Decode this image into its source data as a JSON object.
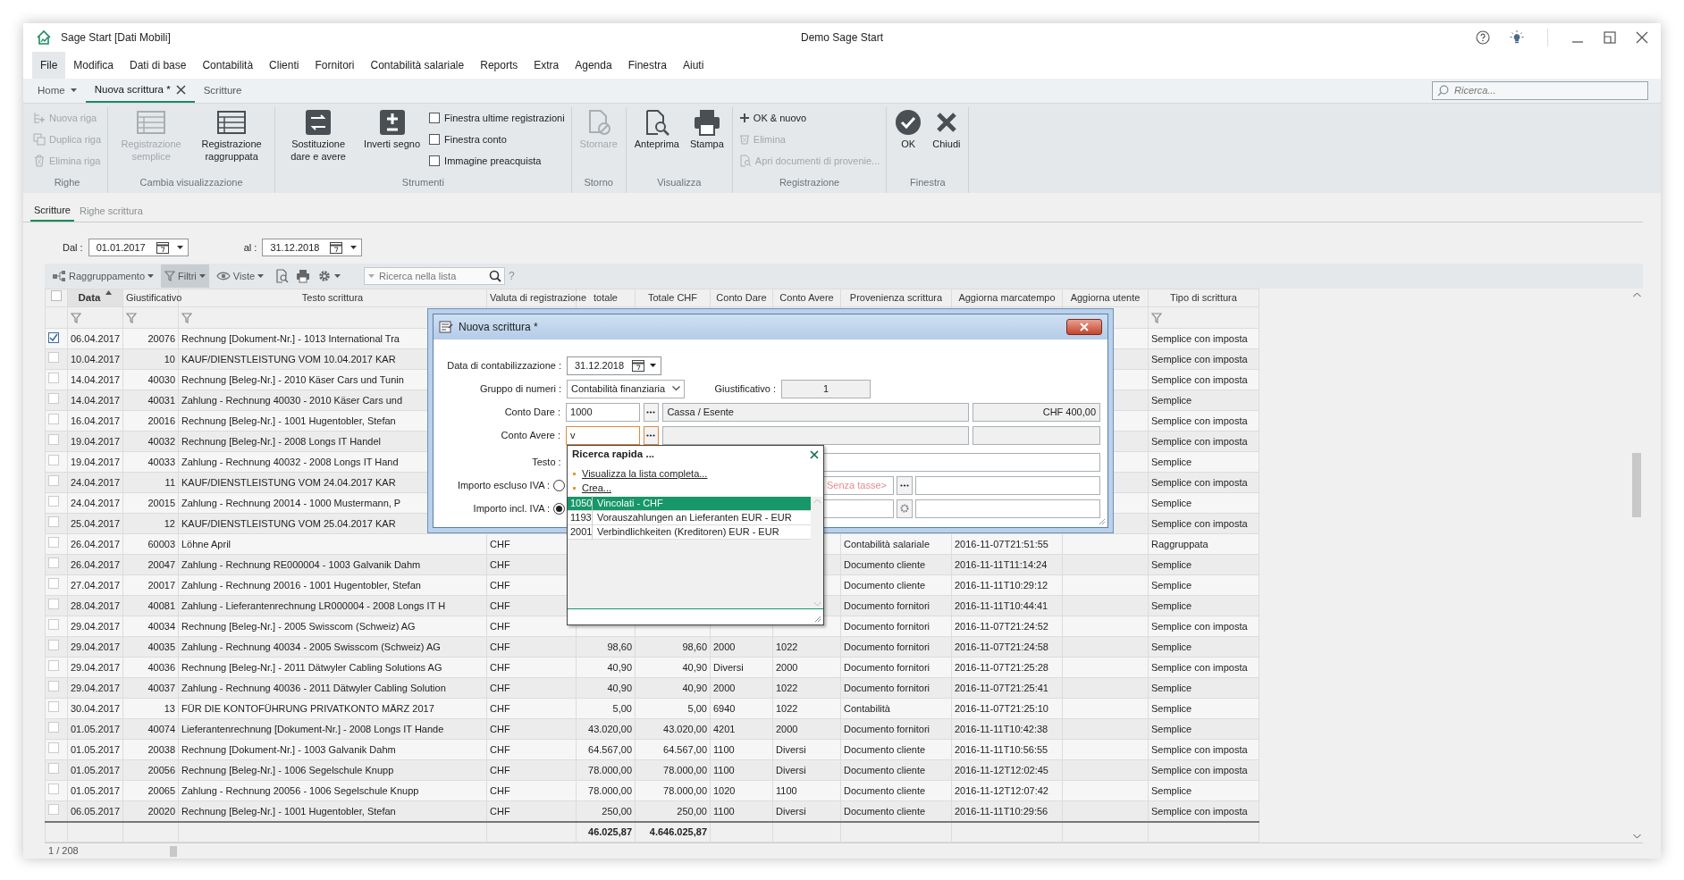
{
  "window": {
    "title": "Sage Start [Dati Mobili]",
    "center_title": "Demo Sage Start"
  },
  "menu": [
    {
      "label": "File",
      "selected": true
    },
    {
      "label": "Modifica",
      "selected": false
    },
    {
      "label": "Dati di base",
      "selected": false
    },
    {
      "label": "Contabilità",
      "selected": false
    },
    {
      "label": "Clienti",
      "selected": false
    },
    {
      "label": "Fornitori",
      "selected": false
    },
    {
      "label": "Contabilità salariale",
      "selected": false
    },
    {
      "label": "Reports",
      "selected": false
    },
    {
      "label": "Extra",
      "selected": false
    },
    {
      "label": "Agenda",
      "selected": false
    },
    {
      "label": "Finestra",
      "selected": false
    },
    {
      "label": "Aiuti",
      "selected": false
    }
  ],
  "doc_tabs": [
    {
      "label": "Home",
      "kind": "home",
      "selected": false
    },
    {
      "label": "Nuova scrittura *",
      "kind": "document",
      "selected": true
    },
    {
      "label": "Scritture",
      "kind": "plain",
      "selected": false
    }
  ],
  "global_search": {
    "placeholder": "Ricerca..."
  },
  "ribbon": [
    {
      "label": "Righe",
      "items": [
        {
          "kind": "small",
          "label": "Nuova riga",
          "disabled": true
        },
        {
          "kind": "small",
          "label": "Duplica riga",
          "disabled": true
        },
        {
          "kind": "small",
          "label": "Elimina riga",
          "disabled": true
        }
      ]
    },
    {
      "label": "Cambia visualizzazione",
      "items": [
        {
          "kind": "large",
          "label": "Registrazione semplice",
          "disabled": true
        },
        {
          "kind": "large",
          "label": "Registrazione raggruppata",
          "disabled": false
        }
      ]
    },
    {
      "label": "Strumenti",
      "items": [
        {
          "kind": "large",
          "label": "Sostituzione dare e avere",
          "disabled": false
        },
        {
          "kind": "large",
          "label": "Inverti segno",
          "disabled": false
        },
        {
          "kind": "check",
          "label": "Finestra ultime registrazioni",
          "checked": false
        },
        {
          "kind": "check",
          "label": "Finestra conto",
          "checked": false
        },
        {
          "kind": "check",
          "label": "Immagine preacquista",
          "checked": false
        }
      ]
    },
    {
      "label": "Storno",
      "items": [
        {
          "kind": "large",
          "label": "Stornare",
          "disabled": true
        }
      ]
    },
    {
      "label": "Visualizza",
      "items": [
        {
          "kind": "large",
          "label": "Anteprima",
          "disabled": false
        },
        {
          "kind": "large",
          "label": "Stampa",
          "disabled": false
        }
      ]
    },
    {
      "label": "Registrazione",
      "items": [
        {
          "kind": "small",
          "label": "OK & nuovo",
          "disabled": false
        },
        {
          "kind": "small",
          "label": "Elimina",
          "disabled": true
        },
        {
          "kind": "small",
          "label": "Apri documenti di provenie...",
          "disabled": true
        }
      ]
    },
    {
      "label": "Finestra",
      "items": [
        {
          "kind": "large",
          "label": "OK",
          "disabled": false
        },
        {
          "kind": "large",
          "label": "Chiudi",
          "disabled": false
        }
      ]
    }
  ],
  "sub_tabs": [
    {
      "label": "Scritture",
      "selected": true
    },
    {
      "label": "Righe scrittura",
      "selected": false
    }
  ],
  "date_filter": {
    "from_label": "Dal :",
    "from": "01.01.2017",
    "to_label": "al :",
    "to": "31.12.2018"
  },
  "toolbar": {
    "buttons": [
      {
        "label": "Raggruppamento",
        "pressed": false
      },
      {
        "label": "Filtri",
        "pressed": true
      },
      {
        "label": "Viste",
        "pressed": false
      }
    ],
    "search_placeholder": "Ricerca nella lista",
    "help": "?"
  },
  "table": {
    "all_checked": false,
    "columns": [
      {
        "label": "Data",
        "sorted": true
      },
      {
        "label": "Giustificativo",
        "sorted": false
      },
      {
        "label": "Testo scrittura",
        "sorted": false
      },
      {
        "label": "Valuta di registrazione",
        "sorted": false
      },
      {
        "label": "totale",
        "sorted": false
      },
      {
        "label": "Totale CHF",
        "sorted": false
      },
      {
        "label": "Conto Dare",
        "sorted": false
      },
      {
        "label": "Conto Avere",
        "sorted": false
      },
      {
        "label": "Provenienza scrittura",
        "sorted": false
      },
      {
        "label": "Aggiorna marcatempo",
        "sorted": false
      },
      {
        "label": "Aggiorna utente",
        "sorted": false
      },
      {
        "label": "Tipo di scrittura",
        "sorted": false
      }
    ],
    "rows": [
      {
        "checked": true,
        "date": "06.04.2017",
        "voucher": "20076",
        "text": "Rechnung [Dokument-Nr.] - 1013 International Tra",
        "type": "Semplice con imposta"
      },
      {
        "checked": false,
        "date": "10.04.2017",
        "voucher": "10",
        "text": "KAUF/DIENSTLEISTUNG VOM 10.04.2017 KAR",
        "type": "Semplice con imposta"
      },
      {
        "checked": false,
        "date": "14.04.2017",
        "voucher": "40030",
        "text": "Rechnung [Beleg-Nr.] - 2010 Käser Cars und Tunin",
        "type": "Semplice con imposta"
      },
      {
        "checked": false,
        "date": "14.04.2017",
        "voucher": "40031",
        "text": "Zahlung - Rechnung 40030 - 2010 Käser Cars und",
        "type": "Semplice"
      },
      {
        "checked": false,
        "date": "16.04.2017",
        "voucher": "20016",
        "text": "Rechnung [Beleg-Nr.] - 1001 Hugentobler, Stefan",
        "type": "Semplice con imposta"
      },
      {
        "checked": false,
        "date": "19.04.2017",
        "voucher": "40032",
        "text": "Rechnung [Beleg-Nr.] - 2008 Longs IT Handel",
        "type": "Semplice con imposta"
      },
      {
        "checked": false,
        "date": "19.04.2017",
        "voucher": "40033",
        "text": "Zahlung - Rechnung 40032 - 2008 Longs IT Hand",
        "type": "Semplice"
      },
      {
        "checked": false,
        "date": "24.04.2017",
        "voucher": "11",
        "text": "KAUF/DIENSTLEISTUNG VOM 24.04.2017 KAR",
        "type": "Semplice con imposta"
      },
      {
        "checked": false,
        "date": "24.04.2017",
        "voucher": "20015",
        "text": "Zahlung - Rechnung 20014 - 1000 Mustermann, P",
        "type": "Semplice"
      },
      {
        "checked": false,
        "date": "25.04.2017",
        "voucher": "12",
        "text": "KAUF/DIENSTLEISTUNG VOM 25.04.2017 KAR",
        "type": "Semplice con imposta"
      },
      {
        "checked": false,
        "date": "26.04.2017",
        "voucher": "60003",
        "text": "Löhne April",
        "currency": "CHF",
        "source": "Contabilità salariale",
        "timestamp": "2016-11-07T21:51:55",
        "type": "Raggruppata"
      },
      {
        "checked": false,
        "date": "26.04.2017",
        "voucher": "20047",
        "text": "Zahlung - Rechnung RE000004 - 1003 Galvanik Dahm",
        "currency": "CHF",
        "source": "Documento cliente",
        "timestamp": "2016-11-11T11:14:24",
        "type": "Semplice"
      },
      {
        "checked": false,
        "date": "27.04.2017",
        "voucher": "20017",
        "text": "Zahlung - Rechnung 20016 - 1001 Hugentobler, Stefan",
        "currency": "CHF",
        "source": "Documento cliente",
        "timestamp": "2016-11-11T10:29:12",
        "type": "Semplice"
      },
      {
        "checked": false,
        "date": "28.04.2017",
        "voucher": "40081",
        "text": "Zahlung - Lieferantenrechnung LR000004 - 2008 Longs IT H",
        "currency": "CHF",
        "source": "Documento fornitori",
        "timestamp": "2016-11-11T10:44:41",
        "type": "Semplice"
      },
      {
        "checked": false,
        "date": "29.04.2017",
        "voucher": "40034",
        "text": "Rechnung [Beleg-Nr.] - 2005 Swisscom (Schweiz) AG",
        "currency": "CHF",
        "source": "Documento fornitori",
        "timestamp": "2016-11-07T21:24:52",
        "type": "Semplice con imposta"
      },
      {
        "checked": false,
        "date": "29.04.2017",
        "voucher": "40035",
        "text": "Zahlung - Rechnung 40034 - 2005 Swisscom (Schweiz) AG",
        "currency": "CHF",
        "total": "98,60",
        "total_chf": "98,60",
        "debit": "2000",
        "credit": "1022",
        "source": "Documento fornitori",
        "timestamp": "2016-11-07T21:24:58",
        "type": "Semplice"
      },
      {
        "checked": false,
        "date": "29.04.2017",
        "voucher": "40036",
        "text": "Rechnung [Beleg-Nr.] - 2011 Dätwyler Cabling Solutions AG",
        "currency": "CHF",
        "total": "40,90",
        "total_chf": "40,90",
        "debit": "Diversi",
        "credit": "2000",
        "source": "Documento fornitori",
        "timestamp": "2016-11-07T21:25:28",
        "type": "Semplice con imposta"
      },
      {
        "checked": false,
        "date": "29.04.2017",
        "voucher": "40037",
        "text": "Zahlung - Rechnung 40036 - 2011 Dätwyler Cabling Solution",
        "currency": "CHF",
        "total": "40,90",
        "total_chf": "40,90",
        "debit": "2000",
        "credit": "1022",
        "source": "Documento fornitori",
        "timestamp": "2016-11-07T21:25:41",
        "type": "Semplice"
      },
      {
        "checked": false,
        "date": "30.04.2017",
        "voucher": "13",
        "text": "FÜR DIE KONTOFÜHRUNG PRIVATKONTO MÄRZ 2017",
        "currency": "CHF",
        "total": "5,00",
        "total_chf": "5,00",
        "debit": "6940",
        "credit": "1022",
        "source": "Contabilità",
        "timestamp": "2016-11-07T21:25:10",
        "type": "Semplice"
      },
      {
        "checked": false,
        "date": "01.05.2017",
        "voucher": "40074",
        "text": "Lieferantenrechnung [Dokument-Nr.] - 2008 Longs IT Hande",
        "currency": "CHF",
        "total": "43.020,00",
        "total_chf": "43.020,00",
        "debit": "4201",
        "credit": "2000",
        "source": "Documento fornitori",
        "timestamp": "2016-11-11T10:42:38",
        "type": "Semplice"
      },
      {
        "checked": false,
        "date": "01.05.2017",
        "voucher": "20038",
        "text": "Rechnung [Dokument-Nr.] - 1003 Galvanik Dahm",
        "currency": "CHF",
        "total": "64.567,00",
        "total_chf": "64.567,00",
        "debit": "1100",
        "credit": "Diversi",
        "source": "Documento cliente",
        "timestamp": "2016-11-11T10:56:55",
        "type": "Semplice con imposta"
      },
      {
        "checked": false,
        "date": "01.05.2017",
        "voucher": "20056",
        "text": "Rechnung [Beleg-Nr.] - 1006 Segelschule Knupp",
        "currency": "CHF",
        "total": "78.000,00",
        "total_chf": "78.000,00",
        "debit": "1100",
        "credit": "Diversi",
        "source": "Documento cliente",
        "timestamp": "2016-11-12T12:02:45",
        "type": "Semplice con imposta"
      },
      {
        "checked": false,
        "date": "01.05.2017",
        "voucher": "20065",
        "text": "Zahlung - Rechnung 20056 - 1006 Segelschule Knupp",
        "currency": "CHF",
        "total": "78.000,00",
        "total_chf": "78.000,00",
        "debit": "1020",
        "credit": "1100",
        "source": "Documento cliente",
        "timestamp": "2016-11-12T12:07:42",
        "type": "Semplice"
      },
      {
        "checked": false,
        "date": "06.05.2017",
        "voucher": "20020",
        "text": "Rechnung [Beleg-Nr.] - 1001 Hugentobler, Stefan",
        "currency": "CHF",
        "total": "250,00",
        "total_chf": "250,00",
        "debit": "1100",
        "credit": "Diversi",
        "source": "Documento cliente",
        "timestamp": "2016-11-11T10:29:56",
        "type": "Semplice con imposta"
      }
    ],
    "totals": {
      "total": "46.025,87",
      "total_chf": "4.646.025,87"
    }
  },
  "status_bar": {
    "count": "1 / 208"
  },
  "dialog": {
    "title": "Nuova scrittura *",
    "posting_date": {
      "label": "Data di contabilizzazione :",
      "value": "31.12.2018"
    },
    "number_group": {
      "label": "Gruppo di numeri :",
      "value": "Contabilità finanziaria"
    },
    "voucher": {
      "label": "Giustificativo :",
      "value": "1"
    },
    "debit": {
      "label": "Conto Dare :",
      "value": "1000",
      "description": "Cassa / Esente",
      "amount": "CHF 400,00",
      "focused": false
    },
    "credit": {
      "label": "Conto Avere :",
      "value": "v",
      "focused": true
    },
    "text": {
      "label": "Testo :"
    },
    "amounts": [
      {
        "label": "Importo escluso IVA :",
        "selected": false,
        "placeholder": "Senza tasse>"
      },
      {
        "label": "Importo incl. IVA :",
        "selected": true
      }
    ]
  },
  "quick_search": {
    "title": "Ricerca rapida ...",
    "links": [
      "Visualizza la lista completa...",
      "Crea..."
    ],
    "results": [
      {
        "code": "1050",
        "name": "Vincolati - CHF",
        "selected": true
      },
      {
        "code": "1193",
        "name": "Vorauszahlungen an Lieferanten EUR - EUR",
        "selected": false
      },
      {
        "code": "2001",
        "name": "Verbindlichkeiten (Kreditoren) EUR - EUR",
        "selected": false
      }
    ]
  }
}
